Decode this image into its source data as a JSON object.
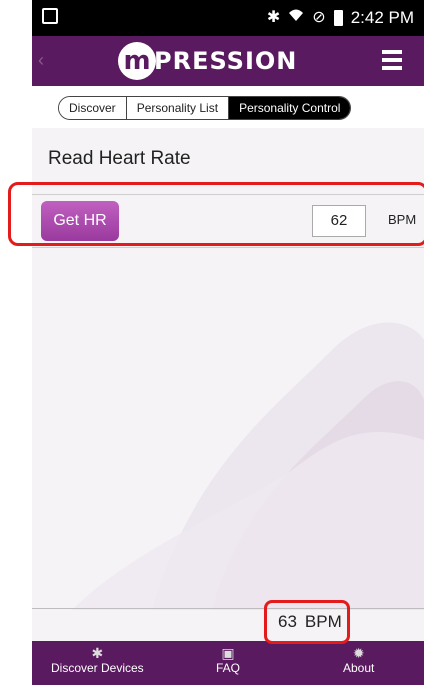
{
  "status_bar": {
    "time": "2:42 PM"
  },
  "header": {
    "logo_letter": "m",
    "logo_text": "PRESSION"
  },
  "tabs": [
    {
      "label": "Discover"
    },
    {
      "label": "Personality List"
    },
    {
      "label": "Personality Control",
      "active": true
    }
  ],
  "page": {
    "title": "Read Heart Rate"
  },
  "hr_control": {
    "button_label": "Get HR",
    "value": "62",
    "unit": "BPM"
  },
  "footer_reading": {
    "value": "63",
    "unit": "BPM"
  },
  "bottom_nav": [
    {
      "label": "Discover Devices",
      "icon": "bluetooth-icon"
    },
    {
      "label": "FAQ",
      "icon": "chip-icon"
    },
    {
      "label": "About",
      "icon": "gear-icon"
    }
  ],
  "colors": {
    "brand": "#5a1a5f",
    "button": "#b050b4",
    "annotation": "#e41b1b"
  }
}
